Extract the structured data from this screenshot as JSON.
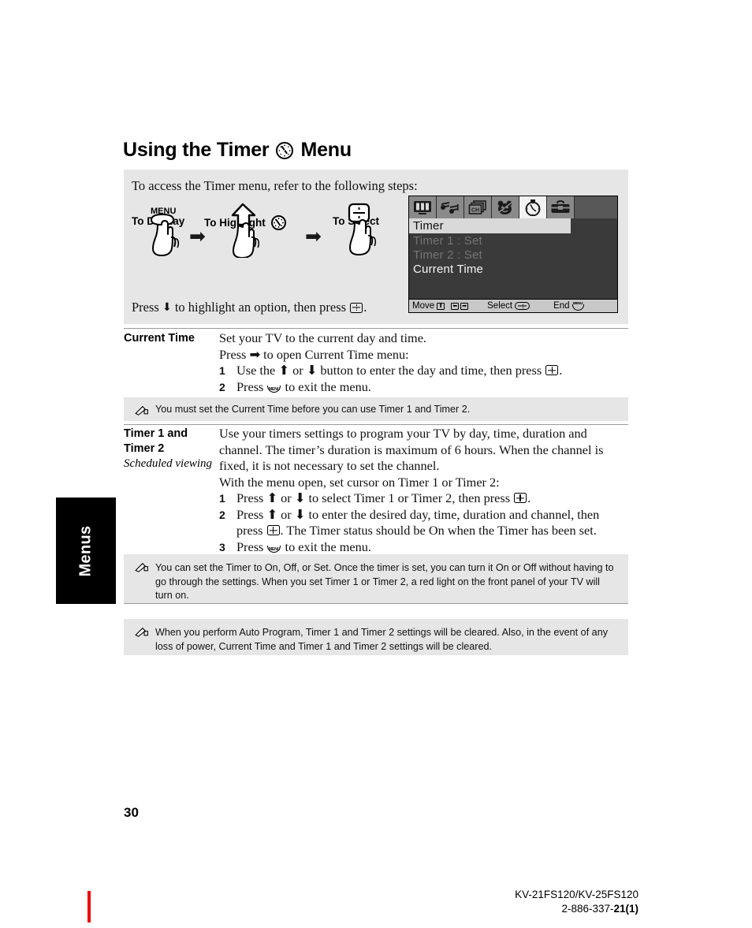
{
  "page": {
    "title_before_icon": "Using the Timer",
    "title_icon": "clock-icon",
    "title_after_icon": "Menu",
    "page_number": "30"
  },
  "steps_panel": {
    "intro": "To access the Timer menu, refer to the following steps:",
    "col_display": "To Display",
    "col_highlight": "To Highlight",
    "col_highlight_icon": "clock-icon",
    "col_select": "To Select",
    "menu_button_label": "MENU",
    "arrow_glyph": "➡",
    "press_text_a": "Press",
    "press_arrow": "⬇",
    "press_text_b": "to highlight an option, then press",
    "press_text_c": "."
  },
  "tv_osd": {
    "icons": [
      "tv-video-icon",
      "audio-music-icon",
      "channel-ch-icon",
      "parental-bear-icon",
      "timer-clock-icon",
      "setup-toolbox-icon"
    ],
    "active_icon_index": 4,
    "menu_title": "Timer",
    "rows": [
      {
        "label": "Timer 1 : Set",
        "state": "dimmed"
      },
      {
        "label": "Timer 2 : Set",
        "state": "dimmed"
      },
      {
        "label": "Current  Time",
        "state": "normal"
      }
    ],
    "footer": {
      "move_label": "Move",
      "select_label": "Select",
      "end_label": "End",
      "end_button_label": "MENU",
      "up_key": "⬆",
      "left_key": "⬅",
      "right_key": "➡"
    }
  },
  "sections": [
    {
      "term": "Current Time",
      "term_sub": "",
      "lines": [
        "Set your TV to the current day and time.",
        "Press ➡ to open Current Time menu:"
      ],
      "steps": [
        {
          "num": "1",
          "text_a": "Use the ⬆ or ⬇ button to enter the day and time, then press",
          "glyph": "enter-button",
          "text_b": "."
        },
        {
          "num": "2",
          "text_a": "Press",
          "glyph": "menu-button",
          "text_b": "to exit the menu."
        }
      ]
    },
    {
      "term": "Timer 1 and Timer 2",
      "term_sub": "Scheduled viewing",
      "lines": [
        "Use your timers settings to program your TV by day, time, duration and channel. The timer’s duration is maximum of 6 hours. When the channel is fixed, it is not necessary to set the channel.",
        "With the menu open, set cursor on Timer 1 or Timer 2:"
      ],
      "steps": [
        {
          "num": "1",
          "text_a": "Press ⬆ or ⬇ to select Timer 1 or Timer 2, then press",
          "glyph": "enter-button",
          "text_b": "."
        },
        {
          "num": "2",
          "text_a": "Press ⬆ or ⬇ to enter the desired day, time, duration and channel, then press",
          "glyph": "enter-button",
          "text_b": ". The Timer status should be On when the Timer has been set."
        },
        {
          "num": "3",
          "text_a": "Press",
          "glyph": "menu-button",
          "text_b": "to exit the menu."
        }
      ]
    }
  ],
  "notes": [
    {
      "text": "You must set the Current Time before you can use Timer 1 and Timer 2."
    },
    {
      "text": "You can set the Timer to On, Off, or Set. Once the timer is set, you can turn it On or Off without having to go through the settings. When you set Timer 1 or Timer 2, a red light on the front panel of your TV will turn on."
    },
    {
      "text": "When you perform Auto Program, Timer 1 and Timer 2 settings will be cleared. Also, in the event of any loss of power, Current Time and Timer 1 and Timer 2 settings will be cleared."
    }
  ],
  "side_tab": {
    "label": "Menus"
  },
  "footer": {
    "model": "KV-21FS120/KV-25FS120",
    "doc_prefix": "2-886-337-",
    "doc_suffix": "21(1)",
    "accent_color": "#ee0000"
  }
}
